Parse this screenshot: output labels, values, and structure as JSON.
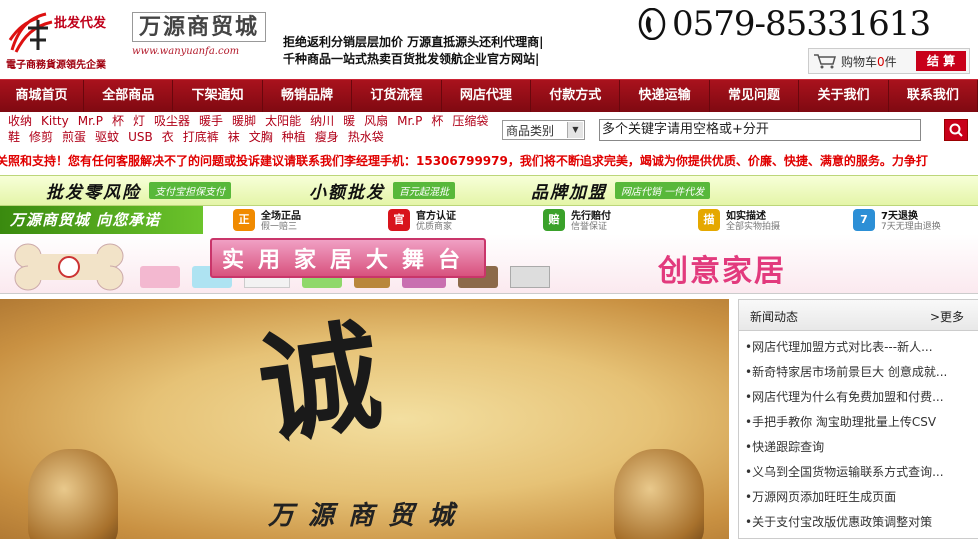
{
  "header": {
    "logo_tag": "批发代发",
    "logo_slogan": "電子商務貨源領先企業",
    "brand_name": "万源商贸城",
    "brand_url": "www.wanyuanfa.com",
    "intro_line1": "拒绝返利分销层层加价 万源直抵源头还利代理商|",
    "intro_line2": "千种商品一站式热卖百货批发领航企业官方网站|",
    "phone": "0579-85331613",
    "cart": {
      "label": "购物车",
      "count": "0",
      "unit": "件",
      "checkout": "结 算"
    }
  },
  "nav": [
    "商城首页",
    "全部商品",
    "下架通知",
    "畅销品牌",
    "订货流程",
    "网店代理",
    "付款方式",
    "快递运输",
    "常见问题",
    "关于我们",
    "联系我们"
  ],
  "categories": {
    "row1": [
      "收纳",
      "Kitty",
      "Mr.P",
      "杯",
      "灯",
      "吸尘器",
      "暖手",
      "暖脚",
      "太阳能",
      "纳川",
      "暖",
      "风扇",
      "Mr.P",
      "杯",
      "压缩袋"
    ],
    "row2": [
      "鞋",
      "修剪",
      "煎蛋",
      "驱蚊",
      "USB",
      "衣",
      "打底裤",
      "袜",
      "文胸",
      "种植",
      "瘦身",
      "热水袋"
    ]
  },
  "search": {
    "category": "商品类别",
    "placeholder": "多个关键字请用空格或+分开"
  },
  "marquee": "关照和支持！您有任何客服解决不了的问题或投诉建议请联系我们李经理手机：15306799979，我们将不断追求完美，竭诚为你提供优质、价廉、快捷、满意的服务。力争打",
  "banner1": [
    {
      "title": "批发零风险",
      "sub": "支付宝担保支付"
    },
    {
      "title": "小额批发",
      "sub": "百元起混批"
    },
    {
      "title": "品牌加盟",
      "sub": "网店代销 一件代发"
    }
  ],
  "promise": {
    "title": "万源商贸城 向您承诺",
    "items": [
      {
        "icon": "正",
        "t1": "全场正品",
        "t2": "假一赔三",
        "color": "#f08a00"
      },
      {
        "icon": "官",
        "t1": "官方认证",
        "t2": "优质商家",
        "color": "#d8141c"
      },
      {
        "icon": "赔",
        "t1": "先行赔付",
        "t2": "信誉保证",
        "color": "#3aa12a"
      },
      {
        "icon": "描",
        "t1": "如实描述",
        "t2": "全部实物拍摄",
        "color": "#e5a800"
      },
      {
        "icon": "7",
        "t1": "7天退换",
        "t2": "7天无理由退换",
        "color": "#2c8fd6"
      }
    ]
  },
  "banner3": {
    "title": "实用家居大舞台",
    "tagline": "创意家居"
  },
  "main_image": {
    "char": "诚",
    "name": "万源商贸城"
  },
  "news": {
    "title": "新闻动态",
    "more": ">更多",
    "items": [
      "•网店代理加盟方式对比表---新人...",
      "•新奇特家居市场前景巨大 创意成就...",
      "•网店代理为什么有免费加盟和付费...",
      "•手把手教你 淘宝助理批量上传CSV",
      "•快递跟踪查询",
      "•义乌到全国货物运输联系方式查询...",
      "•万源网页添加旺旺生成页面",
      "•关于支付宝改版优惠政策调整对策"
    ]
  }
}
